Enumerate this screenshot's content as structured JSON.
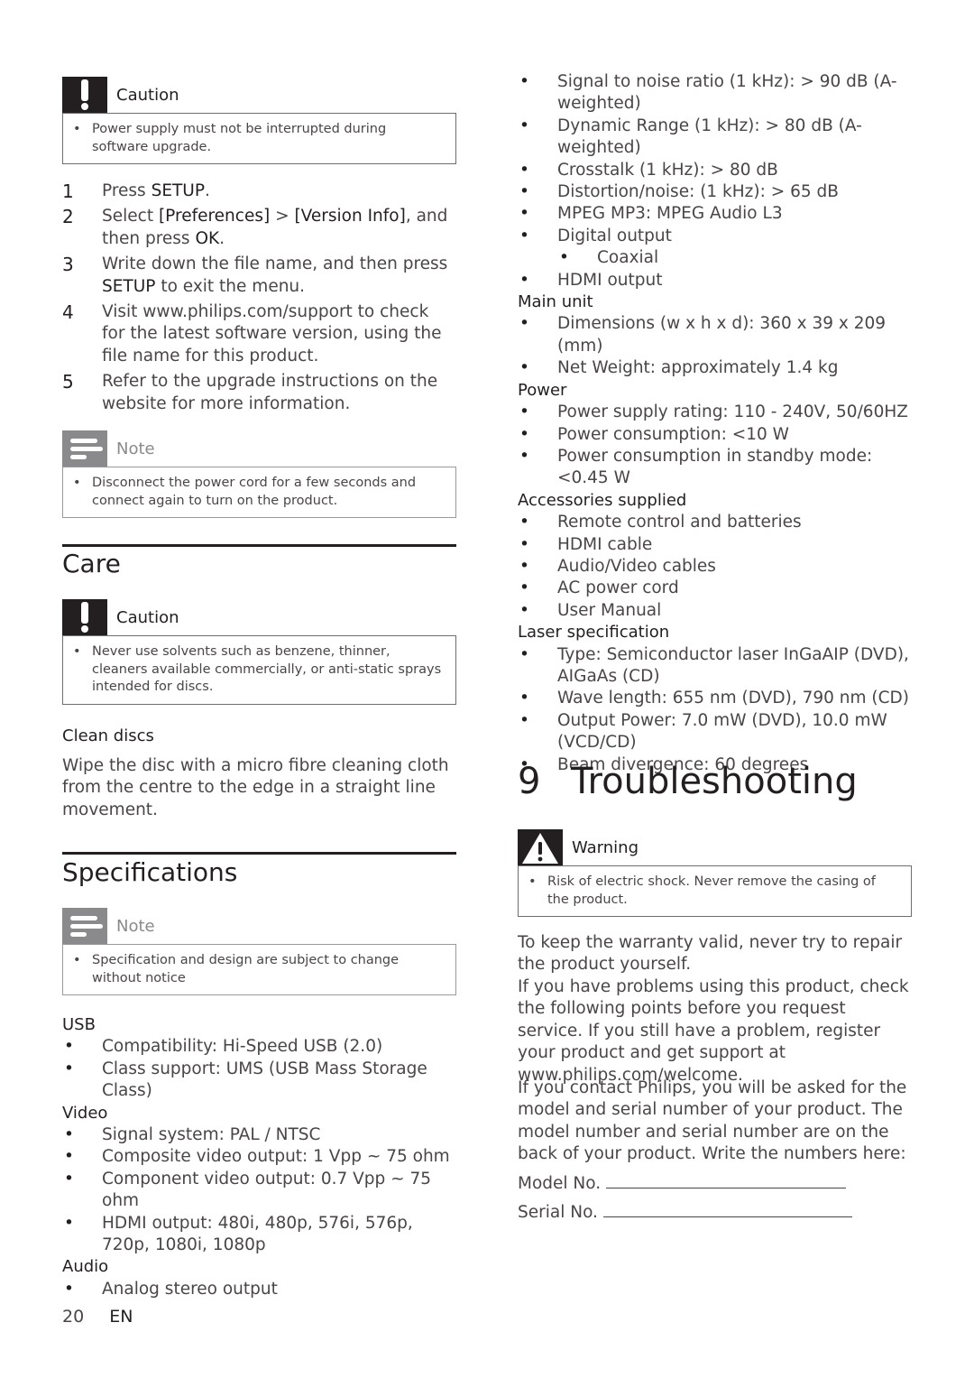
{
  "left": {
    "caution1": {
      "title": "Caution",
      "icon": "exclamation-icon",
      "items": [
        "Power supply must not be interrupted during software upgrade."
      ]
    },
    "steps": [
      {
        "num": "1",
        "parts": [
          {
            "t": "Press "
          },
          {
            "b": "SETUP"
          },
          {
            "t": "."
          }
        ]
      },
      {
        "num": "2",
        "parts": [
          {
            "t": "Select "
          },
          {
            "b": "[Preferences]"
          },
          {
            "t": " > "
          },
          {
            "b": "[Version Info]"
          },
          {
            "t": ", and then press "
          },
          {
            "b": "OK"
          },
          {
            "t": "."
          }
        ]
      },
      {
        "num": "3",
        "parts": [
          {
            "t": "Write down the file name, and then press "
          },
          {
            "b": "SETUP"
          },
          {
            "t": " to exit the menu."
          }
        ]
      },
      {
        "num": "4",
        "parts": [
          {
            "t": "Visit www.philips.com/support to check for the latest software version, using the file name for this product."
          }
        ]
      },
      {
        "num": "5",
        "parts": [
          {
            "t": "Refer to the upgrade instructions on the website for more information."
          }
        ]
      }
    ],
    "note1": {
      "title": "Note",
      "icon": "note-lines-icon",
      "items": [
        "Disconnect the power cord for a few seconds and connect again to turn on the product."
      ]
    },
    "care": {
      "heading": "Care",
      "caution": {
        "title": "Caution",
        "icon": "exclamation-icon",
        "items": [
          "Never use solvents such as benzene, thinner, cleaners available commercially, or anti-static sprays intended for discs."
        ]
      },
      "subheading": "Clean discs",
      "text": "Wipe the disc with a micro fibre cleaning cloth from the centre to the edge in a straight line movement."
    },
    "specifications": {
      "heading": "Specifications",
      "note": {
        "title": "Note",
        "icon": "note-lines-icon",
        "items": [
          "Specification and design are subject to change without notice"
        ]
      },
      "groups": [
        {
          "name": "USB",
          "items": [
            "Compatibility: Hi-Speed USB (2.0)",
            "Class support: UMS (USB Mass Storage Class)"
          ]
        },
        {
          "name": "Video",
          "items": [
            "Signal system: PAL / NTSC",
            "Composite video output: 1 Vpp ~ 75 ohm",
            "Component video output: 0.7 Vpp ~ 75 ohm",
            "HDMI output: 480i, 480p, 576i, 576p, 720p, 1080i, 1080p"
          ]
        },
        {
          "name": "Audio",
          "items": [
            "Analog stereo output"
          ]
        }
      ]
    }
  },
  "right": {
    "spec_groups": [
      {
        "name": "",
        "items": [
          {
            "text": "Signal to noise ratio (1 kHz): > 90 dB (A-weighted)"
          },
          {
            "text": "Dynamic Range (1 kHz): > 80 dB (A-weighted)"
          },
          {
            "text": "Crosstalk (1 kHz): > 80 dB"
          },
          {
            "text": "Distortion/noise: (1 kHz): > 65 dB"
          },
          {
            "text": "MPEG MP3: MPEG Audio L3"
          },
          {
            "text": "Digital output"
          },
          {
            "text": "Coaxial",
            "sub": true
          },
          {
            "text": "HDMI output"
          }
        ]
      },
      {
        "name": "Main unit",
        "items": [
          {
            "text": "Dimensions (w x h x d): 360 x 39 x 209 (mm)"
          },
          {
            "text": "Net Weight: approximately 1.4 kg"
          }
        ]
      },
      {
        "name": "Power",
        "items": [
          {
            "text": "Power supply rating: 110 - 240V, 50/60HZ"
          },
          {
            "text": "Power consumption: <10 W"
          },
          {
            "text": "Power consumption in standby mode: <0.45 W"
          }
        ]
      },
      {
        "name": "Accessories supplied",
        "items": [
          {
            "text": "Remote control and batteries"
          },
          {
            "text": "HDMI cable"
          },
          {
            "text": "Audio/Video cables"
          },
          {
            "text": "AC power cord"
          },
          {
            "text": "User Manual"
          }
        ]
      },
      {
        "name": "Laser specification",
        "items": [
          {
            "text": "Type: Semiconductor laser InGaAIP (DVD), AIGaAs (CD)"
          },
          {
            "text": "Wave length: 655 nm (DVD), 790 nm (CD)"
          },
          {
            "text": "Output Power: 7.0 mW (DVD), 10.0 mW (VCD/CD)"
          },
          {
            "text": "Beam divergence: 60 degrees"
          }
        ]
      }
    ],
    "troubleshooting": {
      "number": "9",
      "heading": "Troubleshooting",
      "warning": {
        "title": "Warning",
        "icon": "warning-triangle-icon",
        "items": [
          "Risk of electric shock. Never remove the casing of the product."
        ]
      },
      "para1": "To keep the warranty valid, never try to repair the product yourself.",
      "para2": "If you have problems using this product, check the following points before you request service. If you still have a problem, register your product and get support at www.philips.com/welcome.",
      "para3": "If you contact Philips, you will be asked for the model and serial number of your product. The model number and serial number are on the back of your product. Write the numbers here:",
      "model_label": "Model No.",
      "serial_label": "Serial No."
    }
  },
  "footer": {
    "page_number": "20",
    "language": "EN"
  }
}
